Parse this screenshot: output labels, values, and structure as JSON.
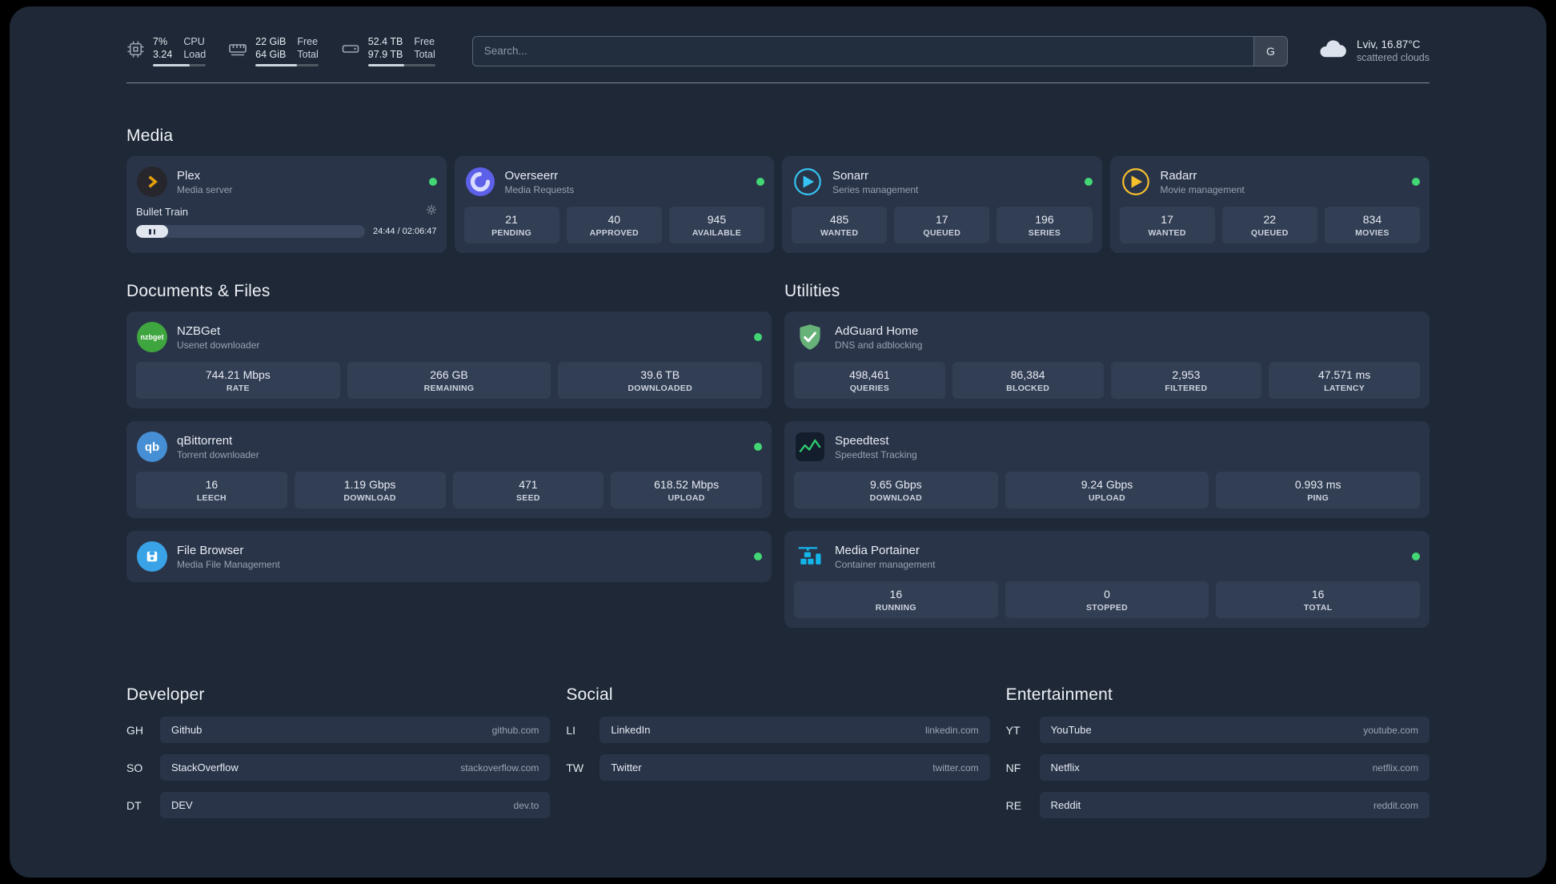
{
  "topbar": {
    "resources": [
      {
        "icon": "cpu-icon",
        "row1_value": "7%",
        "row1_label": "CPU",
        "row2_value": "3.24",
        "row2_label": "Load",
        "progress_pct": 70
      },
      {
        "icon": "memory-icon",
        "row1_value": "22 GiB",
        "row1_label": "Free",
        "row2_value": "64 GiB",
        "row2_label": "Total",
        "progress_pct": 66
      },
      {
        "icon": "disk-icon",
        "row1_value": "52.4 TB",
        "row1_label": "Free",
        "row2_value": "97.9 TB",
        "row2_label": "Total",
        "progress_pct": 54
      }
    ],
    "search": {
      "placeholder": "Search...",
      "button_label": "G"
    },
    "weather": {
      "location": "Lviv, 16.87°C",
      "condition": "scattered clouds"
    }
  },
  "sections": {
    "media": {
      "title": "Media",
      "plex": {
        "name": "Plex",
        "desc": "Media server",
        "player_title": "Bullet Train",
        "player_time": "24:44 / 02:06:47"
      },
      "overseerr": {
        "name": "Overseerr",
        "desc": "Media Requests",
        "stats": [
          {
            "value": "21",
            "label": "PENDING"
          },
          {
            "value": "40",
            "label": "APPROVED"
          },
          {
            "value": "945",
            "label": "AVAILABLE"
          }
        ]
      },
      "sonarr": {
        "name": "Sonarr",
        "desc": "Series management",
        "stats": [
          {
            "value": "485",
            "label": "WANTED"
          },
          {
            "value": "17",
            "label": "QUEUED"
          },
          {
            "value": "196",
            "label": "SERIES"
          }
        ]
      },
      "radarr": {
        "name": "Radarr",
        "desc": "Movie management",
        "stats": [
          {
            "value": "17",
            "label": "WANTED"
          },
          {
            "value": "22",
            "label": "QUEUED"
          },
          {
            "value": "834",
            "label": "MOVIES"
          }
        ]
      }
    },
    "documents": {
      "title": "Documents & Files",
      "nzbget": {
        "name": "NZBGet",
        "desc": "Usenet downloader",
        "icon_text": "nzbget",
        "stats": [
          {
            "value": "744.21 Mbps",
            "label": "RATE"
          },
          {
            "value": "266 GB",
            "label": "REMAINING"
          },
          {
            "value": "39.6 TB",
            "label": "DOWNLOADED"
          }
        ]
      },
      "qbittorrent": {
        "name": "qBittorrent",
        "desc": "Torrent downloader",
        "icon_text": "qb",
        "stats": [
          {
            "value": "16",
            "label": "LEECH"
          },
          {
            "value": "1.19 Gbps",
            "label": "DOWNLOAD"
          },
          {
            "value": "471",
            "label": "SEED"
          },
          {
            "value": "618.52 Mbps",
            "label": "UPLOAD"
          }
        ]
      },
      "filebrowser": {
        "name": "File Browser",
        "desc": "Media File Management"
      }
    },
    "utilities": {
      "title": "Utilities",
      "adguard": {
        "name": "AdGuard Home",
        "desc": "DNS and adblocking",
        "stats": [
          {
            "value": "498,461",
            "label": "QUERIES"
          },
          {
            "value": "86,384",
            "label": "BLOCKED"
          },
          {
            "value": "2,953",
            "label": "FILTERED"
          },
          {
            "value": "47.571 ms",
            "label": "LATENCY"
          }
        ]
      },
      "speedtest": {
        "name": "Speedtest",
        "desc": "Speedtest Tracking",
        "stats": [
          {
            "value": "9.65 Gbps",
            "label": "DOWNLOAD"
          },
          {
            "value": "9.24 Gbps",
            "label": "UPLOAD"
          },
          {
            "value": "0.993 ms",
            "label": "PING"
          }
        ]
      },
      "portainer": {
        "name": "Media Portainer",
        "desc": "Container management",
        "stats": [
          {
            "value": "16",
            "label": "RUNNING"
          },
          {
            "value": "0",
            "label": "STOPPED"
          },
          {
            "value": "16",
            "label": "TOTAL"
          }
        ]
      }
    },
    "developer": {
      "title": "Developer",
      "bookmarks": [
        {
          "abbr": "GH",
          "name": "Github",
          "url": "github.com"
        },
        {
          "abbr": "SO",
          "name": "StackOverflow",
          "url": "stackoverflow.com"
        },
        {
          "abbr": "DT",
          "name": "DEV",
          "url": "dev.to"
        }
      ]
    },
    "social": {
      "title": "Social",
      "bookmarks": [
        {
          "abbr": "LI",
          "name": "LinkedIn",
          "url": "linkedin.com"
        },
        {
          "abbr": "TW",
          "name": "Twitter",
          "url": "twitter.com"
        }
      ]
    },
    "entertainment": {
      "title": "Entertainment",
      "bookmarks": [
        {
          "abbr": "YT",
          "name": "YouTube",
          "url": "youtube.com"
        },
        {
          "abbr": "NF",
          "name": "Netflix",
          "url": "netflix.com"
        },
        {
          "abbr": "RE",
          "name": "Reddit",
          "url": "reddit.com"
        }
      ]
    }
  },
  "colors": {
    "status_online": "#43d675",
    "plex": "#e5a00d",
    "overseerr": "#5d60e8",
    "sonarr": "#35c5f4",
    "radarr": "#f7c12d",
    "nzbget": "#3fa63f",
    "qbittorrent": "#468fd4",
    "adguard": "#67b279",
    "speedtest": "#2ecc71",
    "portainer": "#13b5ea"
  }
}
